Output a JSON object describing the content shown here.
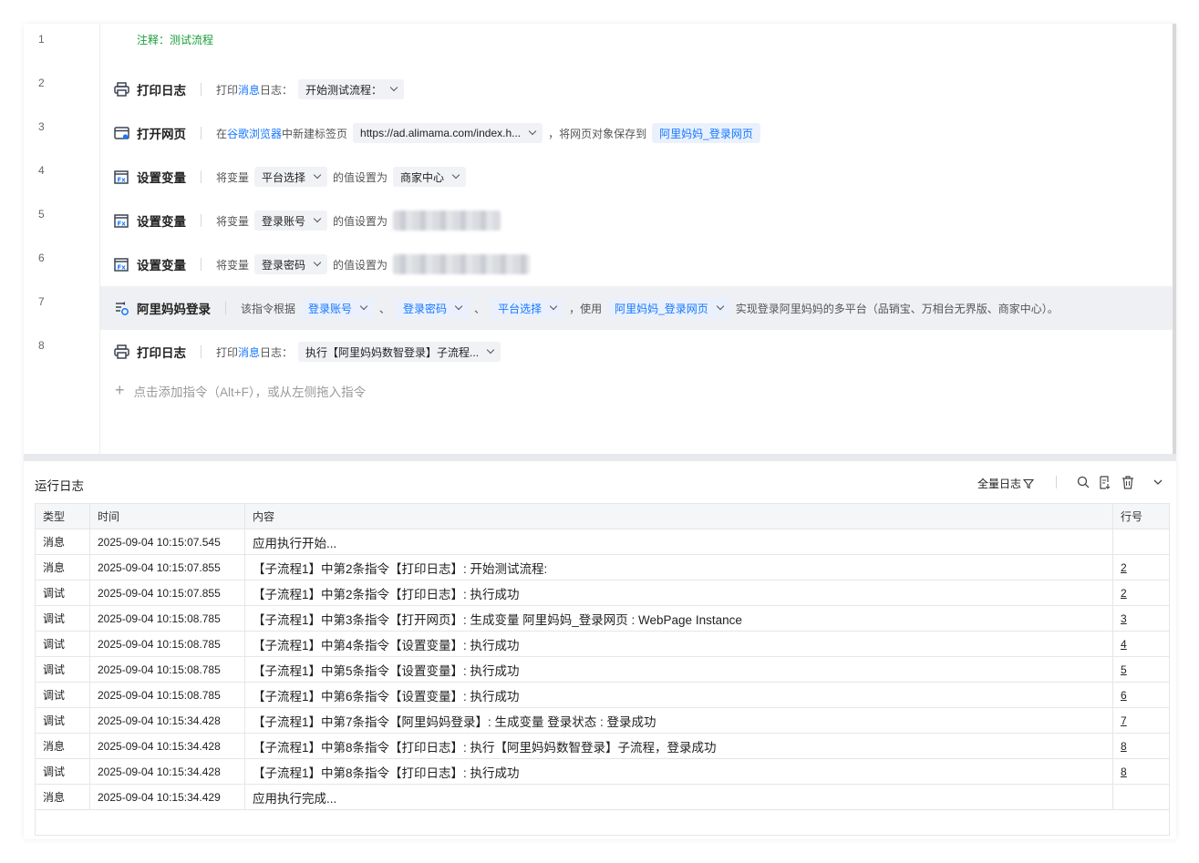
{
  "editor": {
    "line_numbers": [
      "1",
      "2",
      "3",
      "4",
      "5",
      "6",
      "7",
      "8"
    ],
    "comment": "注释：测试流程",
    "rows": [
      {
        "name": "打印日志",
        "icon": "printer-icon",
        "parts": [
          {
            "kind": "text",
            "text": "打印"
          },
          {
            "kind": "blue",
            "text": "消息"
          },
          {
            "kind": "text",
            "text": "日志："
          },
          {
            "kind": "chip",
            "text": "开始测试流程："
          }
        ]
      },
      {
        "name": "打开网页",
        "icon": "browser-window-icon",
        "parts": [
          {
            "kind": "text",
            "text": "在"
          },
          {
            "kind": "blue",
            "text": "谷歌浏览器"
          },
          {
            "kind": "text",
            "text": "中新建标签页"
          },
          {
            "kind": "chip",
            "text": "https://ad.alimama.com/index.h..."
          },
          {
            "kind": "text",
            "text": "，将网页对象保存到"
          },
          {
            "kind": "bluechip-nochev",
            "text": "阿里妈妈_登录网页"
          }
        ]
      },
      {
        "name": "设置变量",
        "icon": "variable-icon",
        "parts": [
          {
            "kind": "text",
            "text": "将变量"
          },
          {
            "kind": "chip",
            "text": "平台选择"
          },
          {
            "kind": "text",
            "text": "的值设置为"
          },
          {
            "kind": "chip",
            "text": "商家中心"
          }
        ]
      },
      {
        "name": "设置变量",
        "icon": "variable-icon",
        "parts": [
          {
            "kind": "text",
            "text": "将变量"
          },
          {
            "kind": "chip",
            "text": "登录账号"
          },
          {
            "kind": "text",
            "text": "的值设置为"
          },
          {
            "kind": "blur",
            "w": 118
          }
        ]
      },
      {
        "name": "设置变量",
        "icon": "variable-icon",
        "parts": [
          {
            "kind": "text",
            "text": "将变量"
          },
          {
            "kind": "chip",
            "text": "登录密码"
          },
          {
            "kind": "text",
            "text": "的值设置为"
          },
          {
            "kind": "blur",
            "w": 150
          }
        ]
      },
      {
        "name": "阿里妈妈登录",
        "icon": "subflow-icon",
        "highlight": true,
        "parts": [
          {
            "kind": "text",
            "text": "该指令根据"
          },
          {
            "kind": "bluechip",
            "text": "登录账号"
          },
          {
            "kind": "text",
            "text": "、"
          },
          {
            "kind": "bluechip",
            "text": "登录密码"
          },
          {
            "kind": "text",
            "text": "、"
          },
          {
            "kind": "bluechip",
            "text": "平台选择"
          },
          {
            "kind": "text",
            "text": "，使用"
          },
          {
            "kind": "bluechip",
            "text": "阿里妈妈_登录网页"
          },
          {
            "kind": "text",
            "text": "实现登录阿里妈妈的多平台（品销宝、万相台无界版、商家中心）。"
          }
        ]
      },
      {
        "name": "打印日志",
        "icon": "printer-icon",
        "parts": [
          {
            "kind": "text",
            "text": "打印"
          },
          {
            "kind": "blue",
            "text": "消息"
          },
          {
            "kind": "text",
            "text": "日志："
          },
          {
            "kind": "chip",
            "text": "执行【阿里妈妈数智登录】子流程..."
          }
        ]
      }
    ],
    "add_hint": "点击添加指令（Alt+F），或从左侧拖入指令"
  },
  "log": {
    "title": "运行日志",
    "filter_label": "全量日志",
    "columns": [
      "类型",
      "时间",
      "内容",
      "行号"
    ],
    "rows": [
      {
        "type": "消息",
        "time": "2025-09-04 10:15:07.545",
        "content": "应用执行开始...",
        "line": ""
      },
      {
        "type": "消息",
        "time": "2025-09-04 10:15:07.855",
        "content": "【子流程1】中第2条指令【打印日志】: 开始测试流程:",
        "line": "2"
      },
      {
        "type": "调试",
        "time": "2025-09-04 10:15:07.855",
        "content": "【子流程1】中第2条指令【打印日志】: 执行成功",
        "line": "2"
      },
      {
        "type": "调试",
        "time": "2025-09-04 10:15:08.785",
        "content": "【子流程1】中第3条指令【打开网页】: 生成变量 阿里妈妈_登录网页 : WebPage Instance",
        "line": "3"
      },
      {
        "type": "调试",
        "time": "2025-09-04 10:15:08.785",
        "content": "【子流程1】中第4条指令【设置变量】: 执行成功",
        "line": "4"
      },
      {
        "type": "调试",
        "time": "2025-09-04 10:15:08.785",
        "content": "【子流程1】中第5条指令【设置变量】: 执行成功",
        "line": "5"
      },
      {
        "type": "调试",
        "time": "2025-09-04 10:15:08.785",
        "content": "【子流程1】中第6条指令【设置变量】: 执行成功",
        "line": "6"
      },
      {
        "type": "调试",
        "time": "2025-09-04 10:15:34.428",
        "content": "【子流程1】中第7条指令【阿里妈妈登录】: 生成变量 登录状态 : 登录成功",
        "line": "7"
      },
      {
        "type": "消息",
        "time": "2025-09-04 10:15:34.428",
        "content": "【子流程1】中第8条指令【打印日志】: 执行【阿里妈妈数智登录】子流程，登录成功",
        "line": "8"
      },
      {
        "type": "调试",
        "time": "2025-09-04 10:15:34.428",
        "content": "【子流程1】中第8条指令【打印日志】: 执行成功",
        "line": "8"
      },
      {
        "type": "消息",
        "time": "2025-09-04 10:15:34.429",
        "content": "应用执行完成...",
        "line": ""
      }
    ]
  }
}
